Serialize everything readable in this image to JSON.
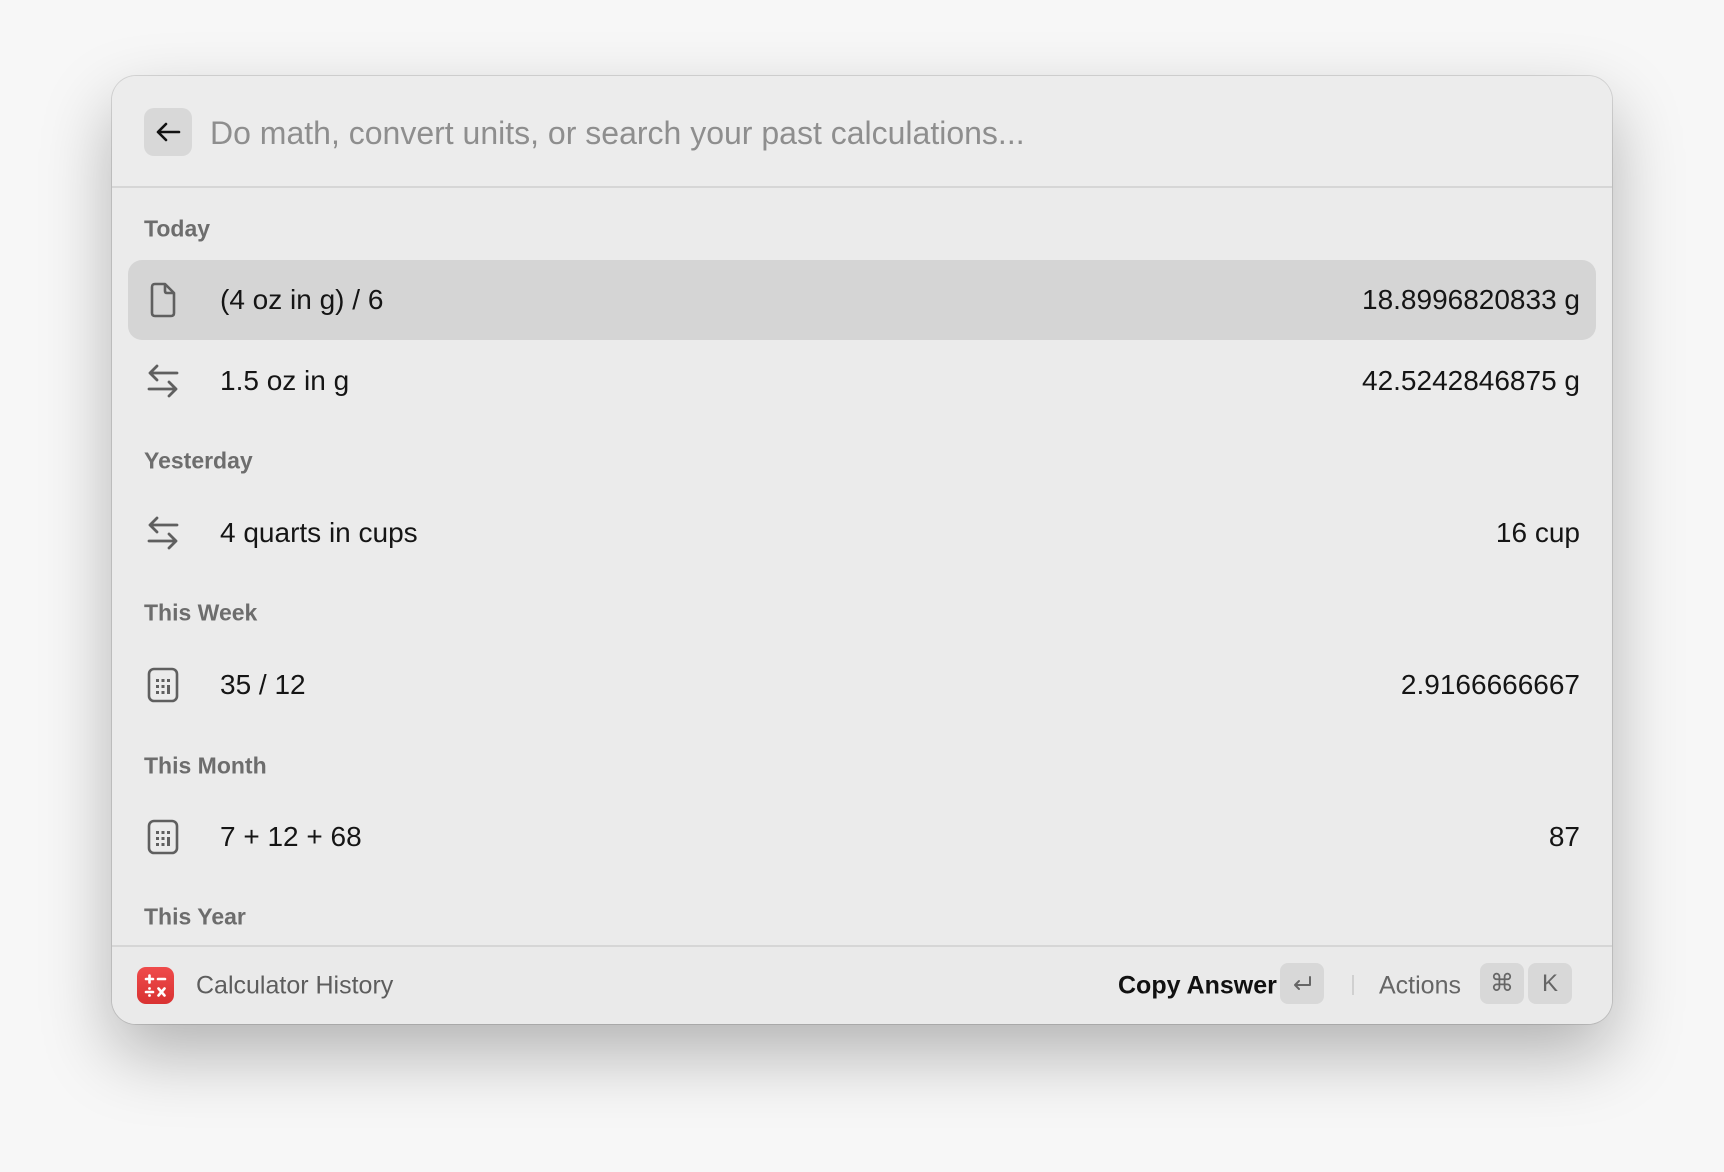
{
  "search": {
    "placeholder": "Do math, convert units, or search your past calculations...",
    "value": ""
  },
  "sections": [
    {
      "label": "Today",
      "items": [
        {
          "icon": "document-icon",
          "expression": "(4 oz in g) / 6",
          "result": "18.8996820833 g",
          "selected": true
        },
        {
          "icon": "convert-arrows-icon",
          "expression": "1.5 oz in g",
          "result": "42.5242846875 g",
          "selected": false
        }
      ]
    },
    {
      "label": "Yesterday",
      "items": [
        {
          "icon": "convert-arrows-icon",
          "expression": "4 quarts in cups",
          "result": "16 cup",
          "selected": false
        }
      ]
    },
    {
      "label": "This Week",
      "items": [
        {
          "icon": "calculator-icon",
          "expression": "35 / 12",
          "result": "2.9166666667",
          "selected": false
        }
      ]
    },
    {
      "label": "This Month",
      "items": [
        {
          "icon": "calculator-icon",
          "expression": "7 + 12 + 68",
          "result": "87",
          "selected": false
        }
      ]
    },
    {
      "label": "This Year",
      "items": []
    }
  ],
  "footer": {
    "app_name": "Calculator History",
    "primary_action": "Copy Answer",
    "primary_shortcut": "↵",
    "actions_label": "Actions",
    "actions_shortcut": [
      "⌘",
      "K"
    ],
    "app_icon_color": "#e03b3b"
  }
}
